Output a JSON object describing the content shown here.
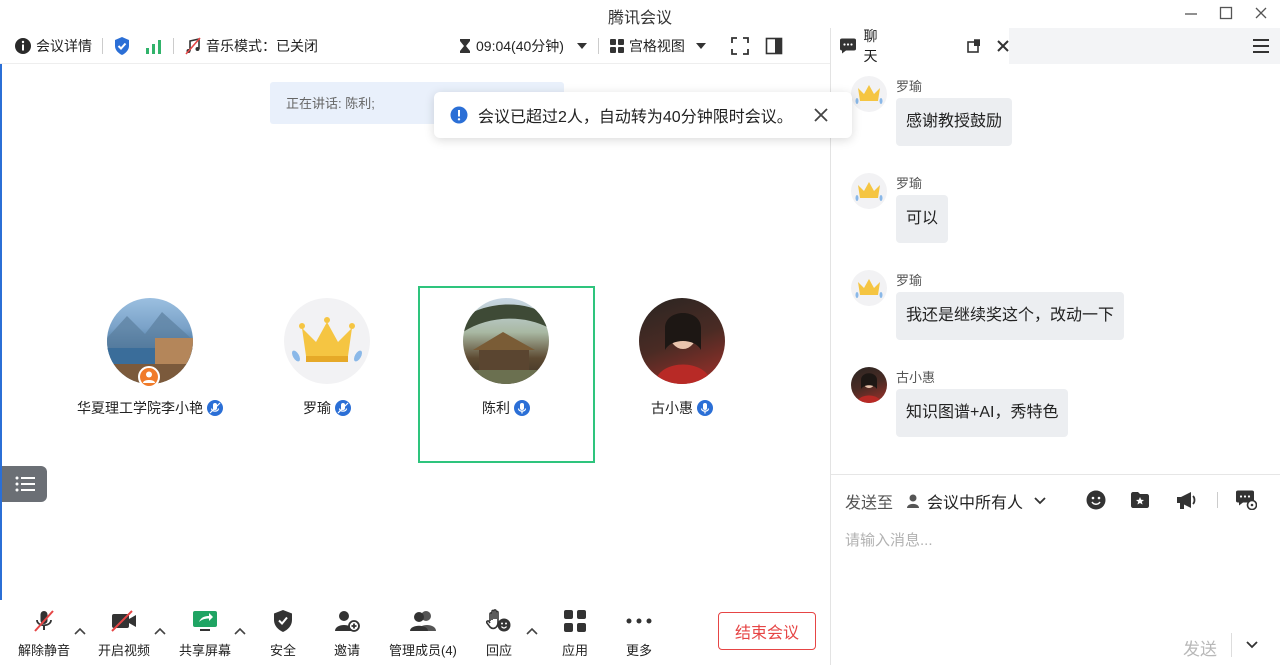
{
  "window": {
    "title": "腾讯会议"
  },
  "toolbar": {
    "meeting_info": "会议详情",
    "music_mode": "音乐模式：已关闭",
    "timer": "09:04(40分钟)",
    "view_mode": "宫格视图"
  },
  "stage": {
    "speaking": "正在讲话: 陈利;",
    "notice": "会议已超过2人，自动转为40分钟限时会议。",
    "participants": [
      {
        "name": "华夏理工学院李小艳"
      },
      {
        "name": "罗瑜"
      },
      {
        "name": "陈利"
      },
      {
        "name": "古小惠"
      }
    ]
  },
  "bottombar": {
    "unmute": "解除静音",
    "start_video": "开启视频",
    "share_screen": "共享屏幕",
    "security": "安全",
    "invite": "邀请",
    "manage_members": "管理成员(4)",
    "reactions": "回应",
    "apps": "应用",
    "more": "更多",
    "end_meeting": "结束会议"
  },
  "chat": {
    "tab_label": "聊天",
    "messages": [
      {
        "sender": "罗瑜",
        "text": "感谢教授鼓励"
      },
      {
        "sender": "罗瑜",
        "text": "可以"
      },
      {
        "sender": "罗瑜",
        "text": "我还是继续奖这个，改动一下"
      },
      {
        "sender": "古小惠",
        "text": "知识图谱+AI，秀特色"
      }
    ],
    "send_to_label": "发送至",
    "send_to_target": "会议中所有人",
    "input_placeholder": "请输入消息...",
    "send_label": "发送"
  },
  "colors": {
    "accent_blue": "#2b6fd6",
    "active_border": "#2ec47d",
    "end_red": "#e64545",
    "share_green": "#1fa463"
  }
}
